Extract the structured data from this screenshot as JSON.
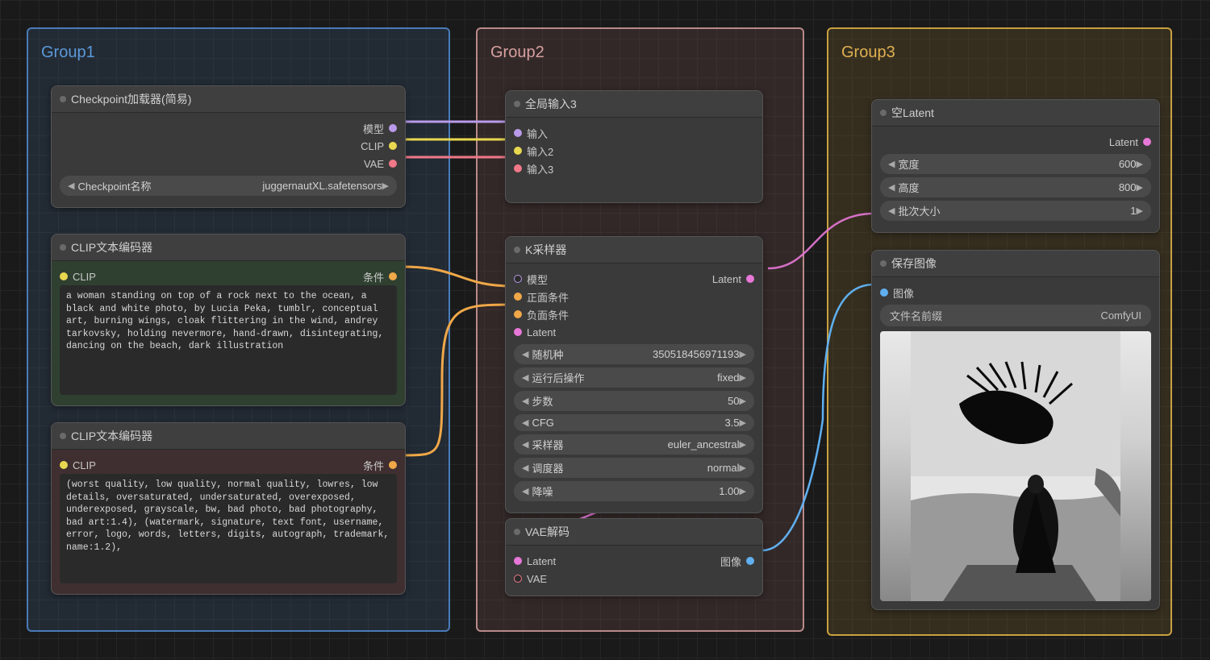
{
  "groups": {
    "g1": "Group1",
    "g2": "Group2",
    "g3": "Group3"
  },
  "checkpoint": {
    "title": "Checkpoint加载器(简易)",
    "out_model": "模型",
    "out_clip": "CLIP",
    "out_vae": "VAE",
    "name_label": "Checkpoint名称",
    "name_value": "juggernautXL.safetensors"
  },
  "clip_pos": {
    "title": "CLIP文本编码器",
    "in": "CLIP",
    "out": "条件",
    "text": "a woman standing on top of a rock next to the ocean, a black and white photo, by Lucia Peka, tumblr, conceptual art, burning wings, cloak flittering in the wind, andrey tarkovsky, holding nevermore, hand-drawn, disintegrating, dancing on the beach, dark illustration"
  },
  "clip_neg": {
    "title": "CLIP文本编码器",
    "in": "CLIP",
    "out": "条件",
    "text": "(worst quality, low quality, normal quality, lowres, low details, oversaturated, undersaturated, overexposed, underexposed, grayscale, bw, bad photo, bad photography, bad art:1.4), (watermark, signature, text font, username, error, logo, words, letters, digits, autograph, trademark, name:1.2),"
  },
  "reroute": {
    "title": "全局输入3",
    "in1": "输入",
    "in2": "输入2",
    "in3": "输入3"
  },
  "ksampler": {
    "title": "K采样器",
    "in_model": "模型",
    "in_pos": "正面条件",
    "in_neg": "负面条件",
    "in_latent": "Latent",
    "out": "Latent",
    "seed_l": "随机种",
    "seed_v": "350518456971193",
    "after_l": "运行后操作",
    "after_v": "fixed",
    "steps_l": "步数",
    "steps_v": "50",
    "cfg_l": "CFG",
    "cfg_v": "3.5",
    "sampler_l": "采样器",
    "sampler_v": "euler_ancestral",
    "sched_l": "调度器",
    "sched_v": "normal",
    "denoise_l": "降噪",
    "denoise_v": "1.00"
  },
  "vae": {
    "title": "VAE解码",
    "in_latent": "Latent",
    "in_vae": "VAE",
    "out": "图像"
  },
  "empty": {
    "title": "空Latent",
    "out": "Latent",
    "w_l": "宽度",
    "w_v": "600",
    "h_l": "高度",
    "h_v": "800",
    "b_l": "批次大小",
    "b_v": "1"
  },
  "save": {
    "title": "保存图像",
    "in": "图像",
    "prefix_l": "文件名前缀",
    "prefix_v": "ComfyUI"
  },
  "colors": {
    "model": "#b89ae8",
    "clip": "#e8d850",
    "vae": "#f07888",
    "cond": "#f0a848",
    "latent": "#e878d8",
    "image": "#60b0f0"
  }
}
